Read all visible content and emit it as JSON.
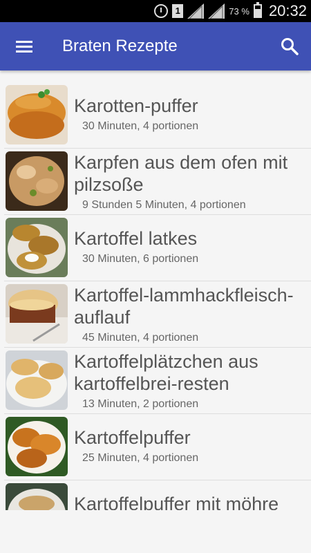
{
  "status": {
    "sim": "1",
    "battery": "73 %",
    "time": "20:32"
  },
  "toolbar": {
    "title": "Braten Rezepte"
  },
  "recipes": [
    {
      "title": "Karotten-puffer",
      "meta": "30 Minuten, 4 portionen"
    },
    {
      "title": "Karpfen aus dem ofen mit pilzsoße",
      "meta": "9 Stunden 5 Minuten, 4 portionen"
    },
    {
      "title": "Kartoffel latkes",
      "meta": "30 Minuten, 6 portionen"
    },
    {
      "title": "Kartoffel-lammhackfleisch-auflauf",
      "meta": "45 Minuten, 4 portionen"
    },
    {
      "title": "Kartoffelplätzchen aus kartoffelbrei-resten",
      "meta": "13 Minuten, 2 portionen"
    },
    {
      "title": "Kartoffelpuffer",
      "meta": "25 Minuten, 4 portionen"
    },
    {
      "title": "Kartoffelpuffer mit möhre",
      "meta": ""
    }
  ],
  "colors": {
    "toolbar": "#3f51b5",
    "background": "#f5f5f5",
    "statusbar": "#000000"
  }
}
